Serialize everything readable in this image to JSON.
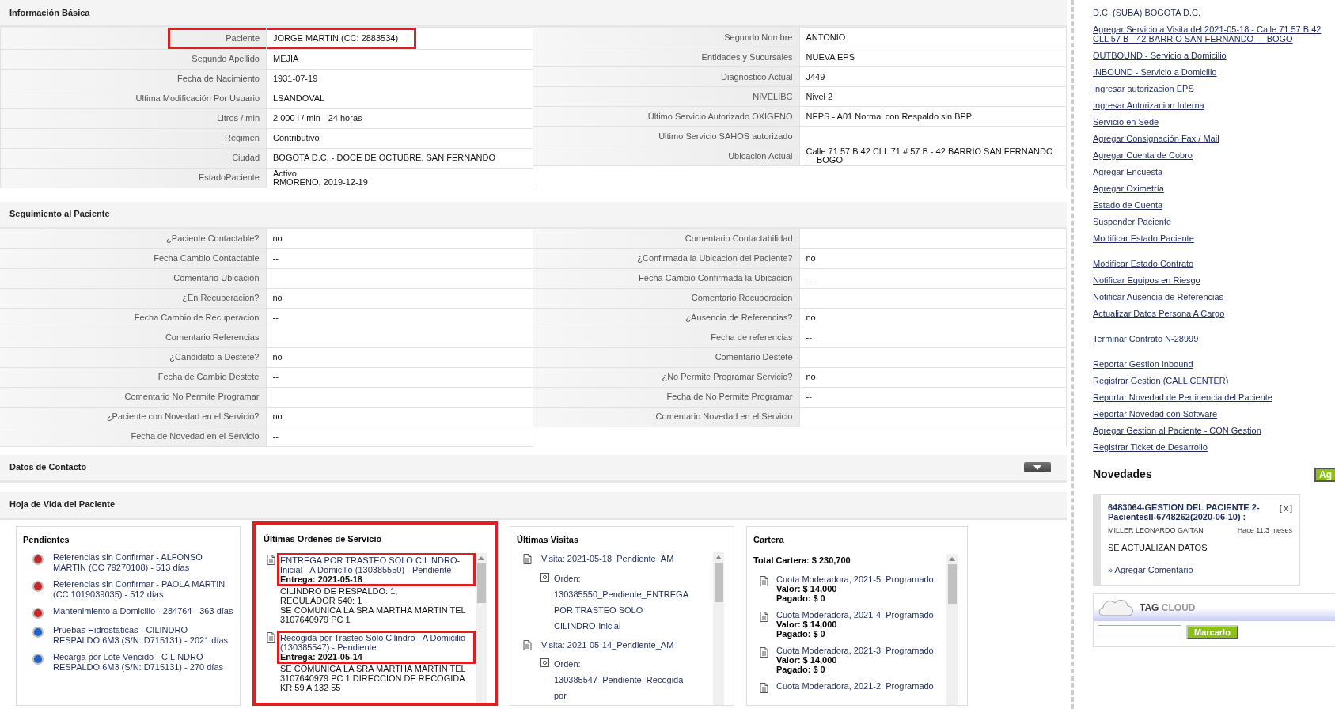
{
  "info_basica": {
    "title": "Información Básica",
    "left": [
      {
        "label": "Paciente",
        "value": [
          "JORGE MARTIN (CC: 2883534)"
        ],
        "highlighted": true
      },
      {
        "label": "Segundo Apellido",
        "value": [
          "MEJIA"
        ],
        "highlighted": false
      },
      {
        "label": "Fecha de Nacimiento",
        "value": [
          "1931-07-19"
        ],
        "highlighted": false
      },
      {
        "label": "Ultima Modificación Por Usuario",
        "value": [
          "LSANDOVAL"
        ],
        "highlighted": false
      },
      {
        "label": "Litros / min",
        "value": [
          "2,000 l / min - 24 horas"
        ],
        "highlighted": false
      },
      {
        "label": "Régimen",
        "value": [
          "Contributivo"
        ],
        "highlighted": false
      },
      {
        "label": "Ciudad",
        "value": [
          "BOGOTA D.C. - DOCE DE OCTUBRE, SAN FERNANDO"
        ],
        "highlighted": false
      },
      {
        "label": "EstadoPaciente",
        "value": [
          "Activo",
          "RMORENO, 2019-12-19"
        ],
        "highlighted": false
      }
    ],
    "right": [
      {
        "label": "Segundo Nombre",
        "value": [
          "ANTONIO"
        ],
        "highlighted": false
      },
      {
        "label": "Entidades y Sucursales",
        "value": [
          "NUEVA EPS"
        ],
        "highlighted": false
      },
      {
        "label": "Diagnostico Actual",
        "value": [
          "J449"
        ],
        "highlighted": false
      },
      {
        "label": "NIVELIBC",
        "value": [
          "Nivel 2"
        ],
        "highlighted": false
      },
      {
        "label": "Último Servicio Autorizado OXIGENO",
        "value": [
          "NEPS - A01 Normal con Respaldo sin BPP"
        ],
        "highlighted": false
      },
      {
        "label": "Ultimo Servicio SAHOS autorizado",
        "highlighted": false
      },
      {
        "label": "Ubicacion Actual",
        "value": [
          "Calle 71 57 B 42 CLL 71 # 57 B - 42 BARRIO SAN FERNANDO",
          "- - BOGO"
        ],
        "highlighted": false
      }
    ]
  },
  "seguimiento": {
    "title": "Seguimiento al Paciente",
    "left": [
      {
        "label": "¿Paciente Contactable?",
        "value": [
          "no"
        ]
      },
      {
        "label": "Fecha Cambio Contactable",
        "value": [
          "--"
        ]
      },
      {
        "label": "Comentario Ubicacion"
      },
      {
        "label": "¿En Recuperacion?",
        "value": [
          "no"
        ]
      },
      {
        "label": "Fecha Cambio de Recuperacion",
        "value": [
          "--"
        ]
      },
      {
        "label": "Comentario Referencias"
      },
      {
        "label": "¿Candidato a Destete?",
        "value": [
          "no"
        ]
      },
      {
        "label": "Fecha de Cambio Destete",
        "value": [
          "--"
        ]
      },
      {
        "label": "Comentario No Permite Programar"
      },
      {
        "label": "¿Paciente con Novedad en el Servicio?",
        "value": [
          "no"
        ]
      },
      {
        "label": "Fecha de Novedad en el Servicio",
        "value": [
          "--"
        ]
      }
    ],
    "right": [
      {
        "label": "Comentario Contactabilidad"
      },
      {
        "label": "¿Confirmada la Ubicacion del Paciente?",
        "value": [
          "no"
        ]
      },
      {
        "label": "Fecha Cambio Confirmada la Ubicacion",
        "value": [
          "--"
        ]
      },
      {
        "label": "Comentario Recuperacion"
      },
      {
        "label": "¿Ausencia de Referencias?",
        "value": [
          "no"
        ]
      },
      {
        "label": "Fecha de referencias",
        "value": [
          "--"
        ]
      },
      {
        "label": "Comentario Destete"
      },
      {
        "label": "¿No Permite Programar Servicio?",
        "value": [
          "no"
        ]
      },
      {
        "label": "Fecha de No Permite Programar",
        "value": [
          "--"
        ]
      },
      {
        "label": "Comentario Novedad en el Servicio"
      }
    ]
  },
  "datos_contacto": {
    "title": "Datos de Contacto",
    "expanded": false
  },
  "hoja_de_vida": {
    "title": "Hoja de Vida del Paciente",
    "pendientes": {
      "title": "Pendientes",
      "items": [
        {
          "text": "Referencias sin Confirmar - ALFONSO MARTIN (CC 79270108) - 513 días",
          "color": "#c62828"
        },
        {
          "text": "Referencias sin Confirmar - PAOLA MARTIN (CC 1019039035) - 512 días",
          "color": "#c62828"
        },
        {
          "text": "Mantenimiento a Domicilio - 284764 - 363 días",
          "color": "#c62828"
        },
        {
          "text": "Pruebas Hidrostaticas - CILINDRO RESPALDO 6M3 (S/N: D715131) - 2021 días",
          "color": "#1e63c4"
        },
        {
          "text": "Recarga por Lote Vencido - CILINDRO RESPALDO 6M3 (S/N: D715131) - 270 días",
          "color": "#1e63c4"
        }
      ]
    },
    "ordenes": {
      "title": "Últimas Ordenes de Servicio",
      "highlighted": true,
      "items": [
        {
          "title": "ENTREGA POR TRASTEO SOLO CILINDRO-Inicial - A Domicilio (130385550) - Pendiente",
          "entrega": "Entrega: 2021-05-18",
          "highlighted": true,
          "details": [
            "CILINDRO DE RESPALDO: 1,",
            "REGULADOR 540: 1",
            "SE COMUNICA LA SRA MARTHA MARTIN TEL 3107640979 PC 1"
          ]
        },
        {
          "title": "Recogida por Trasteo Solo Cilindro - A Domicilio (130385547) - Pendiente",
          "entrega": "Entrega: 2021-05-14",
          "highlighted": true,
          "details": [
            "SE COMUNICA LA SRA MARTHA MARTIN TEL 3107640979 PC 1 DIRECCION DE RECOGIDA KR 59 A 132 55"
          ]
        }
      ]
    },
    "visitas": {
      "title": "Últimas Visitas",
      "items": [
        {
          "visita": "Visita: 2021-05-18_Pendiente_AM",
          "orden": "Orden: 130385550_Pendiente_ENTREGA POR TRASTEO SOLO CILINDRO-Inicial"
        },
        {
          "visita": "Visita: 2021-05-14_Pendiente_AM",
          "orden": "Orden: 130385547_Pendiente_Recogida por"
        }
      ]
    },
    "cartera": {
      "title": "Cartera",
      "total": "Total Cartera: $ 230,700",
      "items": [
        {
          "title": "Cuota Moderadora, 2021-5: Programado",
          "valor": "Valor: $ 14,000",
          "pagado": "Pagado: $ 0"
        },
        {
          "title": "Cuota Moderadora, 2021-4: Programado",
          "valor": "Valor: $ 14,000",
          "pagado": "Pagado: $ 0"
        },
        {
          "title": "Cuota Moderadora, 2021-3: Programado",
          "valor": "Valor: $ 14,000",
          "pagado": "Pagado: $ 0"
        },
        {
          "title": "Cuota Moderadora, 2021-2: Programado"
        }
      ]
    }
  },
  "sidebar": {
    "groups": [
      {
        "links": [
          "D.C. (SUBA) BOGOTA D.C.",
          "Agregar Servicio a Visita del 2021-05-18 - Calle 71 57 B 42 CLL 57 B - 42 BARRIO SAN FERNANDO - - BOGO",
          "OUTBOUND - Servicio a Domicilio",
          "INBOUND - Servicio a Domicilio",
          "Ingresar autorizacion EPS",
          "Ingresar Autorizacion Interna",
          "Servicio en Sede",
          "Agregar Consignación Fax / Mail",
          "Agregar Cuenta de Cobro",
          "Agregar Encuesta",
          "Agregar Oximetría",
          "Estado de Cuenta",
          "Suspender Paciente",
          "Modificar Estado Paciente"
        ]
      },
      {
        "links": [
          "Modificar Estado Contrato",
          "Notificar Equipos en Riesgo",
          "Notificar Ausencia de Referencias",
          "Actualizar Datos Persona A Cargo"
        ]
      },
      {
        "links": [
          "Terminar Contrato N-28999"
        ]
      },
      {
        "links": [
          "Reportar Gestion Inbound",
          "Registrar Gestion (CALL CENTER)",
          "Reportar Novedad de Pertinencia del Paciente",
          "Reportar Novedad con Software",
          "Agregar Gestion al Paciente - CON Gestion",
          "Registrar Ticket de Desarrollo"
        ]
      }
    ]
  },
  "novedades": {
    "title": "Novedades",
    "add_button": "Ag",
    "card": {
      "title": "6483064-GESTION DEL PACIENTE 2-PacientesII-6748262(2020-06-10) :",
      "close": "[ x ]",
      "author": "MILLER LEONARDO GAITAN",
      "time": "Hace 11.3 meses",
      "text": "SE ACTUALIZAN DATOS",
      "comment_link": "» Agregar Comentario"
    }
  },
  "tag_cloud": {
    "title_1": "TAG",
    "title_2": "CLOUD",
    "button": "Marcarlo"
  }
}
